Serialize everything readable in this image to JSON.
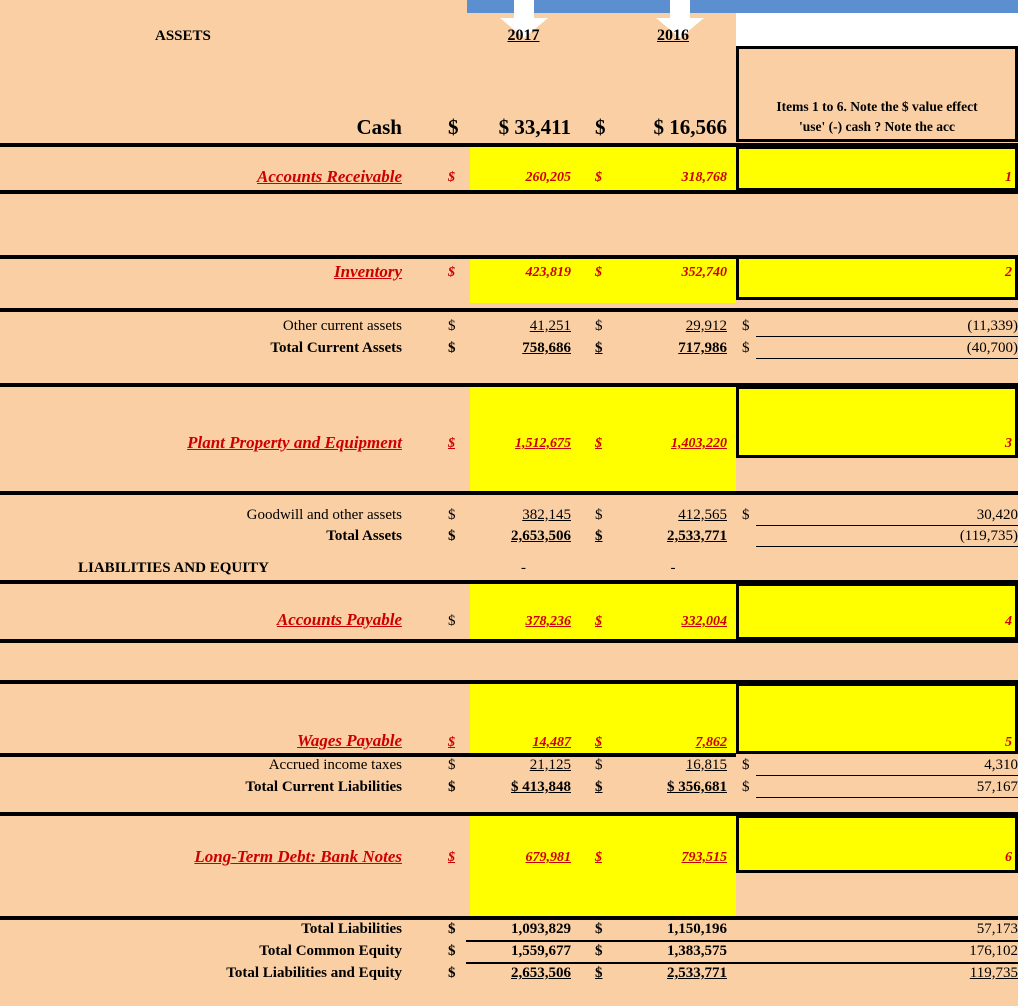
{
  "sheet": {
    "section_assets": "ASSETS",
    "section_liab": "LIABILITIES AND EQUITY",
    "year_2017": "2017",
    "year_2016": "2016",
    "dollar": "$",
    "note_header_line1": "Items 1 to 6. Note the $ value effect",
    "note_header_line2": "'use'  (-) cash ?  Note the acc",
    "rows": [
      {
        "label": "Cash",
        "v2017": "$  33,411",
        "v2016": "$ 16,566",
        "note": "",
        "index": ""
      },
      {
        "label": "Accounts Receivable",
        "v2017": "260,205",
        "v2016": "318,768",
        "note": "",
        "index": "1"
      },
      {
        "label": "Inventory",
        "v2017": "423,819",
        "v2016": "352,740",
        "note": "",
        "index": "2"
      },
      {
        "label": "Other current assets",
        "v2017": "41,251",
        "v2016": "29,912",
        "note": "(11,339)",
        "index": ""
      },
      {
        "label": "Total Current Assets",
        "v2017": "758,686",
        "v2016": "717,986",
        "note": "(40,700)",
        "index": ""
      },
      {
        "label": "Plant Property and Equipment",
        "v2017": "1,512,675",
        "v2016": "1,403,220",
        "note": "",
        "index": "3"
      },
      {
        "label": "Goodwill and other assets",
        "v2017": "382,145",
        "v2016": "412,565",
        "note": "30,420",
        "index": ""
      },
      {
        "label": "Total Assets",
        "v2017": "2,653,506",
        "v2016": "2,533,771",
        "note": "(119,735)",
        "index": ""
      },
      {
        "label": "LIABILITIES AND EQUITY",
        "v2017": "-",
        "v2016": "-",
        "note": "",
        "index": ""
      },
      {
        "label": "Accounts Payable",
        "v2017": "378,236",
        "v2016": "332,004",
        "note": "",
        "index": "4"
      },
      {
        "label": "Wages Payable",
        "v2017": "14,487",
        "v2016": "7,862",
        "note": "",
        "index": "5"
      },
      {
        "label": "Accrued income taxes",
        "v2017": "21,125",
        "v2016": "16,815",
        "note": "4,310",
        "index": ""
      },
      {
        "label": "Total Current Liabilities",
        "v2017": "$  413,848",
        "v2016": "$  356,681",
        "note": "57,167",
        "index": ""
      },
      {
        "label": "Long-Term Debt: Bank Notes",
        "v2017": "679,981",
        "v2016": "793,515",
        "note": "",
        "index": "6"
      },
      {
        "label": "Total Liabilities",
        "v2017": "1,093,829",
        "v2016": "1,150,196",
        "note": "57,173",
        "index": ""
      },
      {
        "label": "Total Common Equity",
        "v2017": "1,559,677",
        "v2016": "1,383,575",
        "note": "176,102",
        "index": ""
      },
      {
        "label": "Total Liabilities and Equity",
        "v2017": "2,653,506",
        "v2016": "2,533,771",
        "note": "119,735",
        "index": ""
      }
    ]
  },
  "colors": {
    "background": "#facfa4",
    "highlight": "#ffff00",
    "accent_blue": "#5b8fcf",
    "red_text": "#cc0000"
  }
}
